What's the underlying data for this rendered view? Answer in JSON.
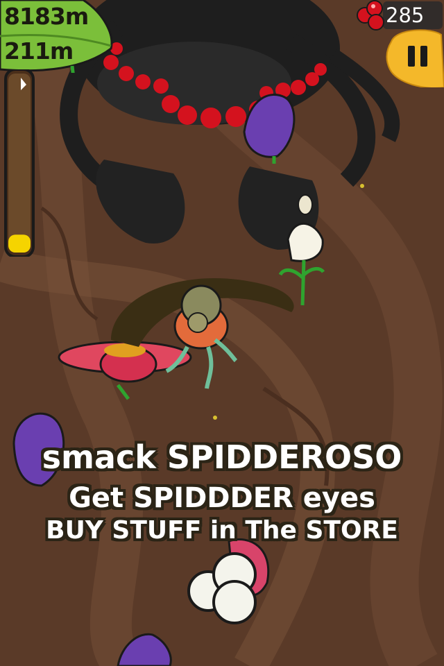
{
  "hud": {
    "total_distance": "8183m",
    "current_distance": "211m",
    "berry_count": "285",
    "progress_fraction": 0.1,
    "pause_icon": "pause-icon",
    "berry_icon": "red-berries-icon"
  },
  "messages": {
    "line1": "smack SPIDDEROSO",
    "line2": "Get SPIDDDER eyes",
    "line3": "BUY STUFF in The STORE"
  },
  "colors": {
    "background": "#5a3a28",
    "leaf": "#7bbf3a",
    "pause_button": "#f4b82a",
    "berry": "#d4121e",
    "progress_fill": "#f5d400",
    "spider": "#1e1e1e",
    "text_outline": "#2b2416"
  }
}
